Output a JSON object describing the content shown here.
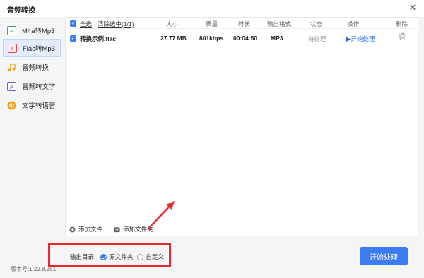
{
  "window": {
    "title": "音频转换",
    "close_glyph": "✕"
  },
  "sidebar": {
    "items": [
      {
        "label": "M4a转Mp3",
        "icon": "m4a-to-mp3-icon",
        "active": false
      },
      {
        "label": "Flac转Mp3",
        "icon": "flac-to-mp3-icon",
        "active": true
      },
      {
        "label": "音频转换",
        "icon": "music-note-icon",
        "active": false
      },
      {
        "label": "音频转文字",
        "icon": "letter-a-icon",
        "active": false
      },
      {
        "label": "文字转语音",
        "icon": "audio-wave-icon",
        "active": false
      }
    ]
  },
  "table": {
    "select_all": "全选",
    "clear_selected": "清除选中(1/1)",
    "columns": [
      "大小",
      "质量",
      "时长",
      "输出格式",
      "状态",
      "操作",
      "删除"
    ],
    "rows": [
      {
        "name": "转换示例.flac",
        "size": "27.77 MB",
        "quality": "801kbps",
        "duration": "00:04:50",
        "format": "MP3",
        "status": "待处理",
        "action": "▶开始处理"
      }
    ]
  },
  "footer": {
    "add_file": "添加文件",
    "add_folder": "添加文件夹"
  },
  "output": {
    "label": "输出目录:",
    "options": [
      {
        "label": "原文件夹",
        "selected": true
      },
      {
        "label": "自定义",
        "selected": false
      }
    ]
  },
  "start_button": "开始处理",
  "version": "版本号:1.22.8.251",
  "colors": {
    "accent": "#3d7cf0",
    "annotation": "#e8262d"
  }
}
